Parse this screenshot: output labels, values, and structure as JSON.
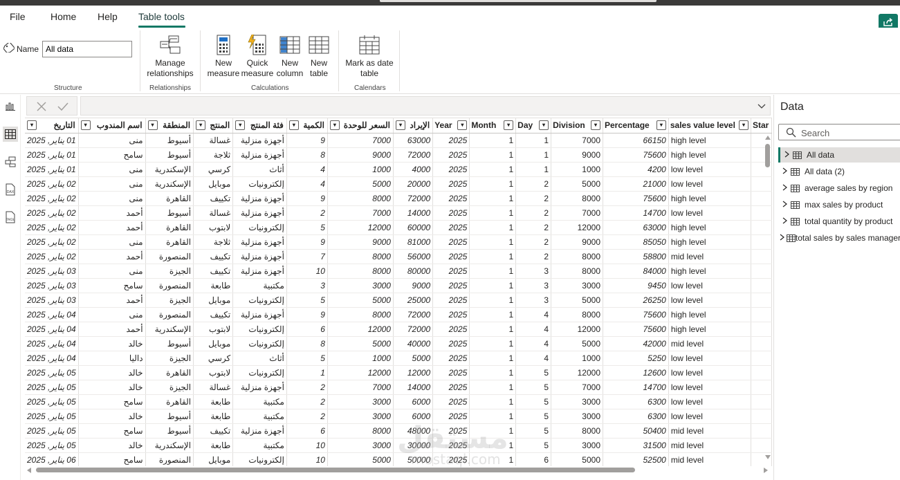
{
  "menu": {
    "file": "File",
    "home": "Home",
    "help": "Help",
    "table_tools": "Table tools"
  },
  "ribbon": {
    "name_label": "Name",
    "name_value": "All data",
    "structure_label": "Structure",
    "manage_relationships": [
      "Manage",
      "relationships"
    ],
    "relationships_label": "Relationships",
    "new_measure": [
      "New",
      "measure"
    ],
    "quick_measure": [
      "Quick",
      "measure"
    ],
    "new_column": [
      "New",
      "column"
    ],
    "new_table": [
      "New",
      "table"
    ],
    "calculations_label": "Calculations",
    "mark_as_date": [
      "Mark as date",
      "table"
    ],
    "calendars_label": "Calendars"
  },
  "left_nav": [
    "report-view-icon",
    "table-view-icon",
    "model-view-icon",
    "dax-query-icon",
    "tmdl-view-icon"
  ],
  "table": {
    "columns": [
      "التاريخ",
      "اسم المندوب",
      "المنطقة",
      "المنتج",
      "فئة المنتج",
      "الكمية",
      "السعر للوحدة",
      "الإيراد",
      "Year",
      "Month",
      "Day",
      "Division",
      "Percentage",
      "sales value level",
      "Star"
    ],
    "rows": [
      [
        "01 يناير, 2025",
        "منى",
        "أسيوط",
        "غسالة",
        "أجهزة منزلية",
        "9",
        "7000",
        "63000",
        "2025",
        "1",
        "1",
        "7000",
        "66150",
        "high level"
      ],
      [
        "01 يناير, 2025",
        "سامح",
        "أسيوط",
        "ثلاجة",
        "أجهزة منزلية",
        "8",
        "9000",
        "72000",
        "2025",
        "1",
        "1",
        "9000",
        "75600",
        "high level"
      ],
      [
        "01 يناير, 2025",
        "منى",
        "الإسكندرية",
        "كرسي",
        "أثاث",
        "4",
        "1000",
        "4000",
        "2025",
        "1",
        "1",
        "1000",
        "4200",
        "low level"
      ],
      [
        "02 يناير, 2025",
        "منى",
        "الإسكندرية",
        "موبايل",
        "إلكترونيات",
        "4",
        "5000",
        "20000",
        "2025",
        "1",
        "2",
        "5000",
        "21000",
        "low level"
      ],
      [
        "02 يناير, 2025",
        "منى",
        "القاهرة",
        "تكييف",
        "أجهزة منزلية",
        "9",
        "8000",
        "72000",
        "2025",
        "1",
        "2",
        "8000",
        "75600",
        "high level"
      ],
      [
        "02 يناير, 2025",
        "أحمد",
        "أسيوط",
        "غسالة",
        "أجهزة منزلية",
        "2",
        "7000",
        "14000",
        "2025",
        "1",
        "2",
        "7000",
        "14700",
        "low level"
      ],
      [
        "02 يناير, 2025",
        "أحمد",
        "القاهرة",
        "لابتوب",
        "إلكترونيات",
        "5",
        "12000",
        "60000",
        "2025",
        "1",
        "2",
        "12000",
        "63000",
        "high level"
      ],
      [
        "02 يناير, 2025",
        "منى",
        "القاهرة",
        "ثلاجة",
        "أجهزة منزلية",
        "9",
        "9000",
        "81000",
        "2025",
        "1",
        "2",
        "9000",
        "85050",
        "high level"
      ],
      [
        "02 يناير, 2025",
        "أحمد",
        "المنصورة",
        "تكييف",
        "أجهزة منزلية",
        "7",
        "8000",
        "56000",
        "2025",
        "1",
        "2",
        "8000",
        "58800",
        "mid level"
      ],
      [
        "03 يناير, 2025",
        "منى",
        "الجيزة",
        "تكييف",
        "أجهزة منزلية",
        "10",
        "8000",
        "80000",
        "2025",
        "1",
        "3",
        "8000",
        "84000",
        "high level"
      ],
      [
        "03 يناير, 2025",
        "سامح",
        "المنصورة",
        "طابعة",
        "مكتبية",
        "3",
        "3000",
        "9000",
        "2025",
        "1",
        "3",
        "3000",
        "9450",
        "low level"
      ],
      [
        "03 يناير, 2025",
        "أحمد",
        "الجيزة",
        "موبايل",
        "إلكترونيات",
        "5",
        "5000",
        "25000",
        "2025",
        "1",
        "3",
        "5000",
        "26250",
        "low level"
      ],
      [
        "04 يناير, 2025",
        "منى",
        "المنصورة",
        "تكييف",
        "أجهزة منزلية",
        "9",
        "8000",
        "72000",
        "2025",
        "1",
        "4",
        "8000",
        "75600",
        "high level"
      ],
      [
        "04 يناير, 2025",
        "أحمد",
        "الإسكندرية",
        "لابتوب",
        "إلكترونيات",
        "6",
        "12000",
        "72000",
        "2025",
        "1",
        "4",
        "12000",
        "75600",
        "high level"
      ],
      [
        "04 يناير, 2025",
        "خالد",
        "أسيوط",
        "موبايل",
        "إلكترونيات",
        "8",
        "5000",
        "40000",
        "2025",
        "1",
        "4",
        "5000",
        "42000",
        "mid level"
      ],
      [
        "04 يناير, 2025",
        "داليا",
        "الجيزة",
        "كرسي",
        "أثاث",
        "5",
        "1000",
        "5000",
        "2025",
        "1",
        "4",
        "1000",
        "5250",
        "low level"
      ],
      [
        "05 يناير, 2025",
        "خالد",
        "القاهرة",
        "لابتوب",
        "إلكترونيات",
        "1",
        "12000",
        "12000",
        "2025",
        "1",
        "5",
        "12000",
        "12600",
        "low level"
      ],
      [
        "05 يناير, 2025",
        "خالد",
        "الجيزة",
        "غسالة",
        "أجهزة منزلية",
        "2",
        "7000",
        "14000",
        "2025",
        "1",
        "5",
        "7000",
        "14700",
        "low level"
      ],
      [
        "05 يناير, 2025",
        "سامح",
        "القاهرة",
        "طابعة",
        "مكتبية",
        "2",
        "3000",
        "6000",
        "2025",
        "1",
        "5",
        "3000",
        "6300",
        "low level"
      ],
      [
        "05 يناير, 2025",
        "خالد",
        "أسيوط",
        "طابعة",
        "مكتبية",
        "2",
        "3000",
        "6000",
        "2025",
        "1",
        "5",
        "3000",
        "6300",
        "low level"
      ],
      [
        "05 يناير, 2025",
        "سامح",
        "أسيوط",
        "تكييف",
        "أجهزة منزلية",
        "6",
        "8000",
        "48000",
        "2025",
        "1",
        "5",
        "8000",
        "50400",
        "mid level"
      ],
      [
        "05 يناير, 2025",
        "خالد",
        "الإسكندرية",
        "طابعة",
        "مكتبية",
        "10",
        "3000",
        "30000",
        "2025",
        "1",
        "5",
        "3000",
        "31500",
        "mid level"
      ],
      [
        "06 يناير, 2025",
        "سامح",
        "المنصورة",
        "موبايل",
        "إلكترونيات",
        "10",
        "5000",
        "50000",
        "2025",
        "1",
        "6",
        "5000",
        "52500",
        "mid level"
      ]
    ]
  },
  "data_pane": {
    "title": "Data",
    "search_placeholder": "Search",
    "items": [
      "All data",
      "All data (2)",
      "average sales by region",
      "max sales by product",
      "total quantity by product",
      "total sales by sales manager"
    ]
  },
  "watermark": {
    "arabic": "مستقل",
    "latin": "mostaql.com"
  },
  "colors": {
    "accent": "#117865",
    "topbar": "#3b3a39"
  }
}
